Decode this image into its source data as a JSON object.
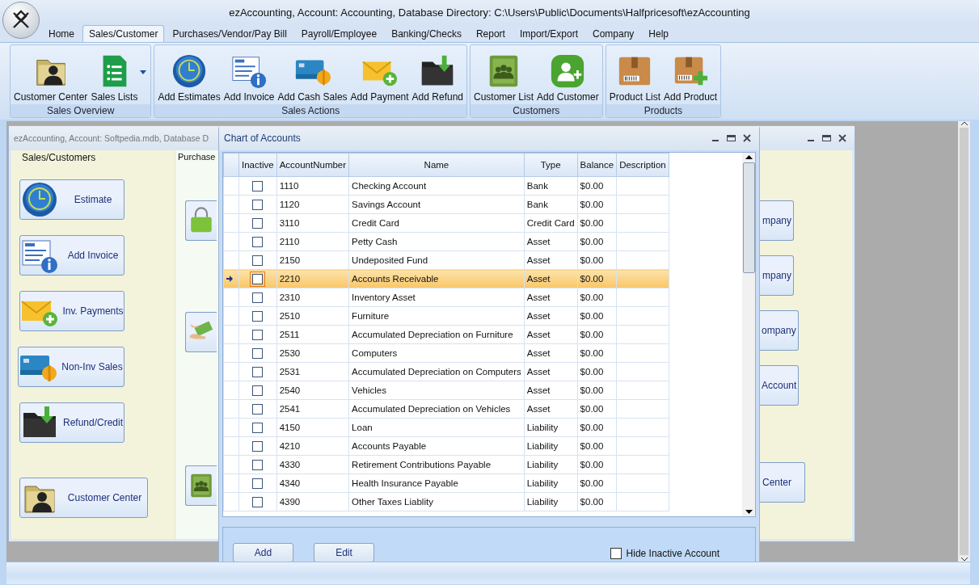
{
  "window": {
    "title": "ezAccounting, Account: Accounting, Database Directory: C:\\Users\\Public\\Documents\\Halfpricesoft\\ezAccounting"
  },
  "menu_tabs": [
    {
      "label": "Home",
      "selected": false
    },
    {
      "label": "Sales/Customer",
      "selected": true
    },
    {
      "label": "Purchases/Vendor/Pay Bill",
      "selected": false
    },
    {
      "label": "Payroll/Employee",
      "selected": false
    },
    {
      "label": "Banking/Checks",
      "selected": false
    },
    {
      "label": "Report",
      "selected": false
    },
    {
      "label": "Import/Export",
      "selected": false
    },
    {
      "label": "Company",
      "selected": false
    },
    {
      "label": "Help",
      "selected": false
    }
  ],
  "ribbon": {
    "groups": [
      {
        "label": "Sales Overview",
        "buttons": [
          {
            "label": "Customer Center",
            "dropdown": false
          },
          {
            "label": "Sales Lists",
            "dropdown": true
          }
        ]
      },
      {
        "label": "Sales Actions",
        "buttons": [
          {
            "label": "Add Estimates",
            "dropdown": false
          },
          {
            "label": "Add Invoice",
            "dropdown": false
          },
          {
            "label": "Add Cash Sales",
            "dropdown": false
          },
          {
            "label": "Add Payment",
            "dropdown": false
          },
          {
            "label": "Add Refund",
            "dropdown": false
          }
        ]
      },
      {
        "label": "Customers",
        "buttons": [
          {
            "label": "Customer List",
            "dropdown": false
          },
          {
            "label": "Add Customer",
            "dropdown": false
          }
        ]
      },
      {
        "label": "Products",
        "buttons": [
          {
            "label": "Product List",
            "dropdown": false
          },
          {
            "label": "Add Product",
            "dropdown": false
          }
        ]
      }
    ]
  },
  "background_window": {
    "title": "ezAccounting, Account: Softpedia.mdb, Database D",
    "sales_panel": {
      "title": "Sales/Customers",
      "buttons": [
        "Estimate",
        "Add Invoice",
        "Inv. Payments",
        "Non-Inv Sales",
        "Refund/Credit",
        "Customer Center"
      ]
    },
    "purchase_panel": {
      "title": "Purchase"
    },
    "right_buttons": [
      "mpany",
      "mpany",
      "ompany",
      "Account",
      "Center"
    ]
  },
  "chart_window": {
    "title": "Chart of Accounts",
    "table": {
      "columns": [
        "Inactive",
        "AccountNumber",
        "Name",
        "Type",
        "Balance",
        "Description"
      ],
      "rows": [
        {
          "number": "1110",
          "name": "Checking Account",
          "type": "Bank",
          "balance": "$0.00",
          "inactive": false,
          "selected": false
        },
        {
          "number": "1120",
          "name": "Savings Account",
          "type": "Bank",
          "balance": "$0.00",
          "inactive": false,
          "selected": false
        },
        {
          "number": "3110",
          "name": "Credit Card",
          "type": "Credit Card",
          "balance": "$0.00",
          "inactive": false,
          "selected": false
        },
        {
          "number": "2110",
          "name": "Petty Cash",
          "type": "Asset",
          "balance": "$0.00",
          "inactive": false,
          "selected": false
        },
        {
          "number": "2150",
          "name": "Undeposited Fund",
          "type": "Asset",
          "balance": "$0.00",
          "inactive": false,
          "selected": false
        },
        {
          "number": "2210",
          "name": "Accounts Receivable",
          "type": "Asset",
          "balance": "$0.00",
          "inactive": false,
          "selected": true
        },
        {
          "number": "2310",
          "name": "Inventory Asset",
          "type": "Asset",
          "balance": "$0.00",
          "inactive": false,
          "selected": false
        },
        {
          "number": "2510",
          "name": "Furniture",
          "type": "Asset",
          "balance": "$0.00",
          "inactive": false,
          "selected": false
        },
        {
          "number": "2511",
          "name": "Accumulated Depreciation on Furniture",
          "type": "Asset",
          "balance": "$0.00",
          "inactive": false,
          "selected": false
        },
        {
          "number": "2530",
          "name": "Computers",
          "type": "Asset",
          "balance": "$0.00",
          "inactive": false,
          "selected": false
        },
        {
          "number": "2531",
          "name": "Accumulated Depreciation on Computers",
          "type": "Asset",
          "balance": "$0.00",
          "inactive": false,
          "selected": false
        },
        {
          "number": "2540",
          "name": "Vehicles",
          "type": "Asset",
          "balance": "$0.00",
          "inactive": false,
          "selected": false
        },
        {
          "number": "2541",
          "name": "Accumulated Depreciation on Vehicles",
          "type": "Asset",
          "balance": "$0.00",
          "inactive": false,
          "selected": false
        },
        {
          "number": "4150",
          "name": "Loan",
          "type": "Liability",
          "balance": "$0.00",
          "inactive": false,
          "selected": false
        },
        {
          "number": "4210",
          "name": "Accounts Payable",
          "type": "Liability",
          "balance": "$0.00",
          "inactive": false,
          "selected": false
        },
        {
          "number": "4330",
          "name": "Retirement Contributions Payable",
          "type": "Liability",
          "balance": "$0.00",
          "inactive": false,
          "selected": false
        },
        {
          "number": "4340",
          "name": "Health Insurance Payable",
          "type": "Liability",
          "balance": "$0.00",
          "inactive": false,
          "selected": false
        },
        {
          "number": "4390",
          "name": "Other Taxes Liablity",
          "type": "Liability",
          "balance": "$0.00",
          "inactive": false,
          "selected": false
        }
      ]
    },
    "buttons": [
      "Add",
      "Edit"
    ],
    "hide_inactive": {
      "label": "Hide Inactive Account",
      "checked": false
    }
  }
}
